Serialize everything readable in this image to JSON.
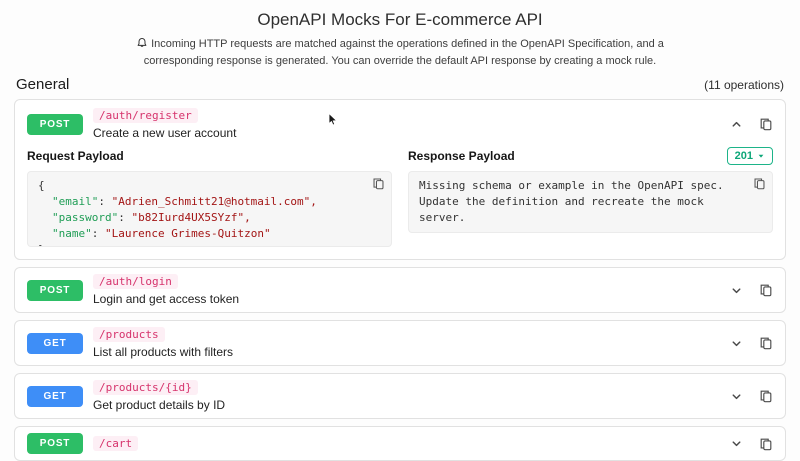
{
  "page": {
    "title": "OpenAPI Mocks For E-commerce API",
    "info_line": "Incoming HTTP requests are matched against the operations defined in the OpenAPI Specification, and a corresponding response is generated. You can override the default API response by creating a mock rule.",
    "section_title": "General",
    "operations_count": "(11 operations)"
  },
  "labels": {
    "request_payload": "Request Payload",
    "response_payload": "Response Payload"
  },
  "icons": {
    "bell": "bell",
    "chevron_up": "chevron-up",
    "chevron_down": "chevron-down",
    "copy": "copy",
    "caret_down": "caret-down"
  },
  "colors": {
    "post_badge": "#2dbe66",
    "get_badge": "#3e8ef7",
    "path_text": "#d6336c",
    "status_border": "#1db489"
  },
  "operations": [
    {
      "method": "POST",
      "path": "/auth/register",
      "description": "Create a new user account",
      "request_json": {
        "open_brace": "{",
        "fields": [
          {
            "key": "\"email\"",
            "sep": ": ",
            "value": "\"Adrien_Schmitt21@hotmail.com\","
          },
          {
            "key": "\"password\"",
            "sep": ": ",
            "value": "\"b82Iurd4UX5SYzf\","
          },
          {
            "key": "\"name\"",
            "sep": ": ",
            "value": "\"Laurence Grimes-Quitzon\""
          }
        ],
        "close_brace": "}"
      },
      "response": {
        "status_code": "201",
        "message": "Missing schema or example in the OpenAPI spec.\nUpdate the definition and recreate the mock server."
      }
    },
    {
      "method": "POST",
      "path": "/auth/login",
      "description": "Login and get access token"
    },
    {
      "method": "GET",
      "path": "/products",
      "description": "List all products with filters"
    },
    {
      "method": "GET",
      "path": "/products/{id}",
      "description": "Get product details by ID"
    },
    {
      "method": "POST",
      "path": "/cart"
    }
  ]
}
